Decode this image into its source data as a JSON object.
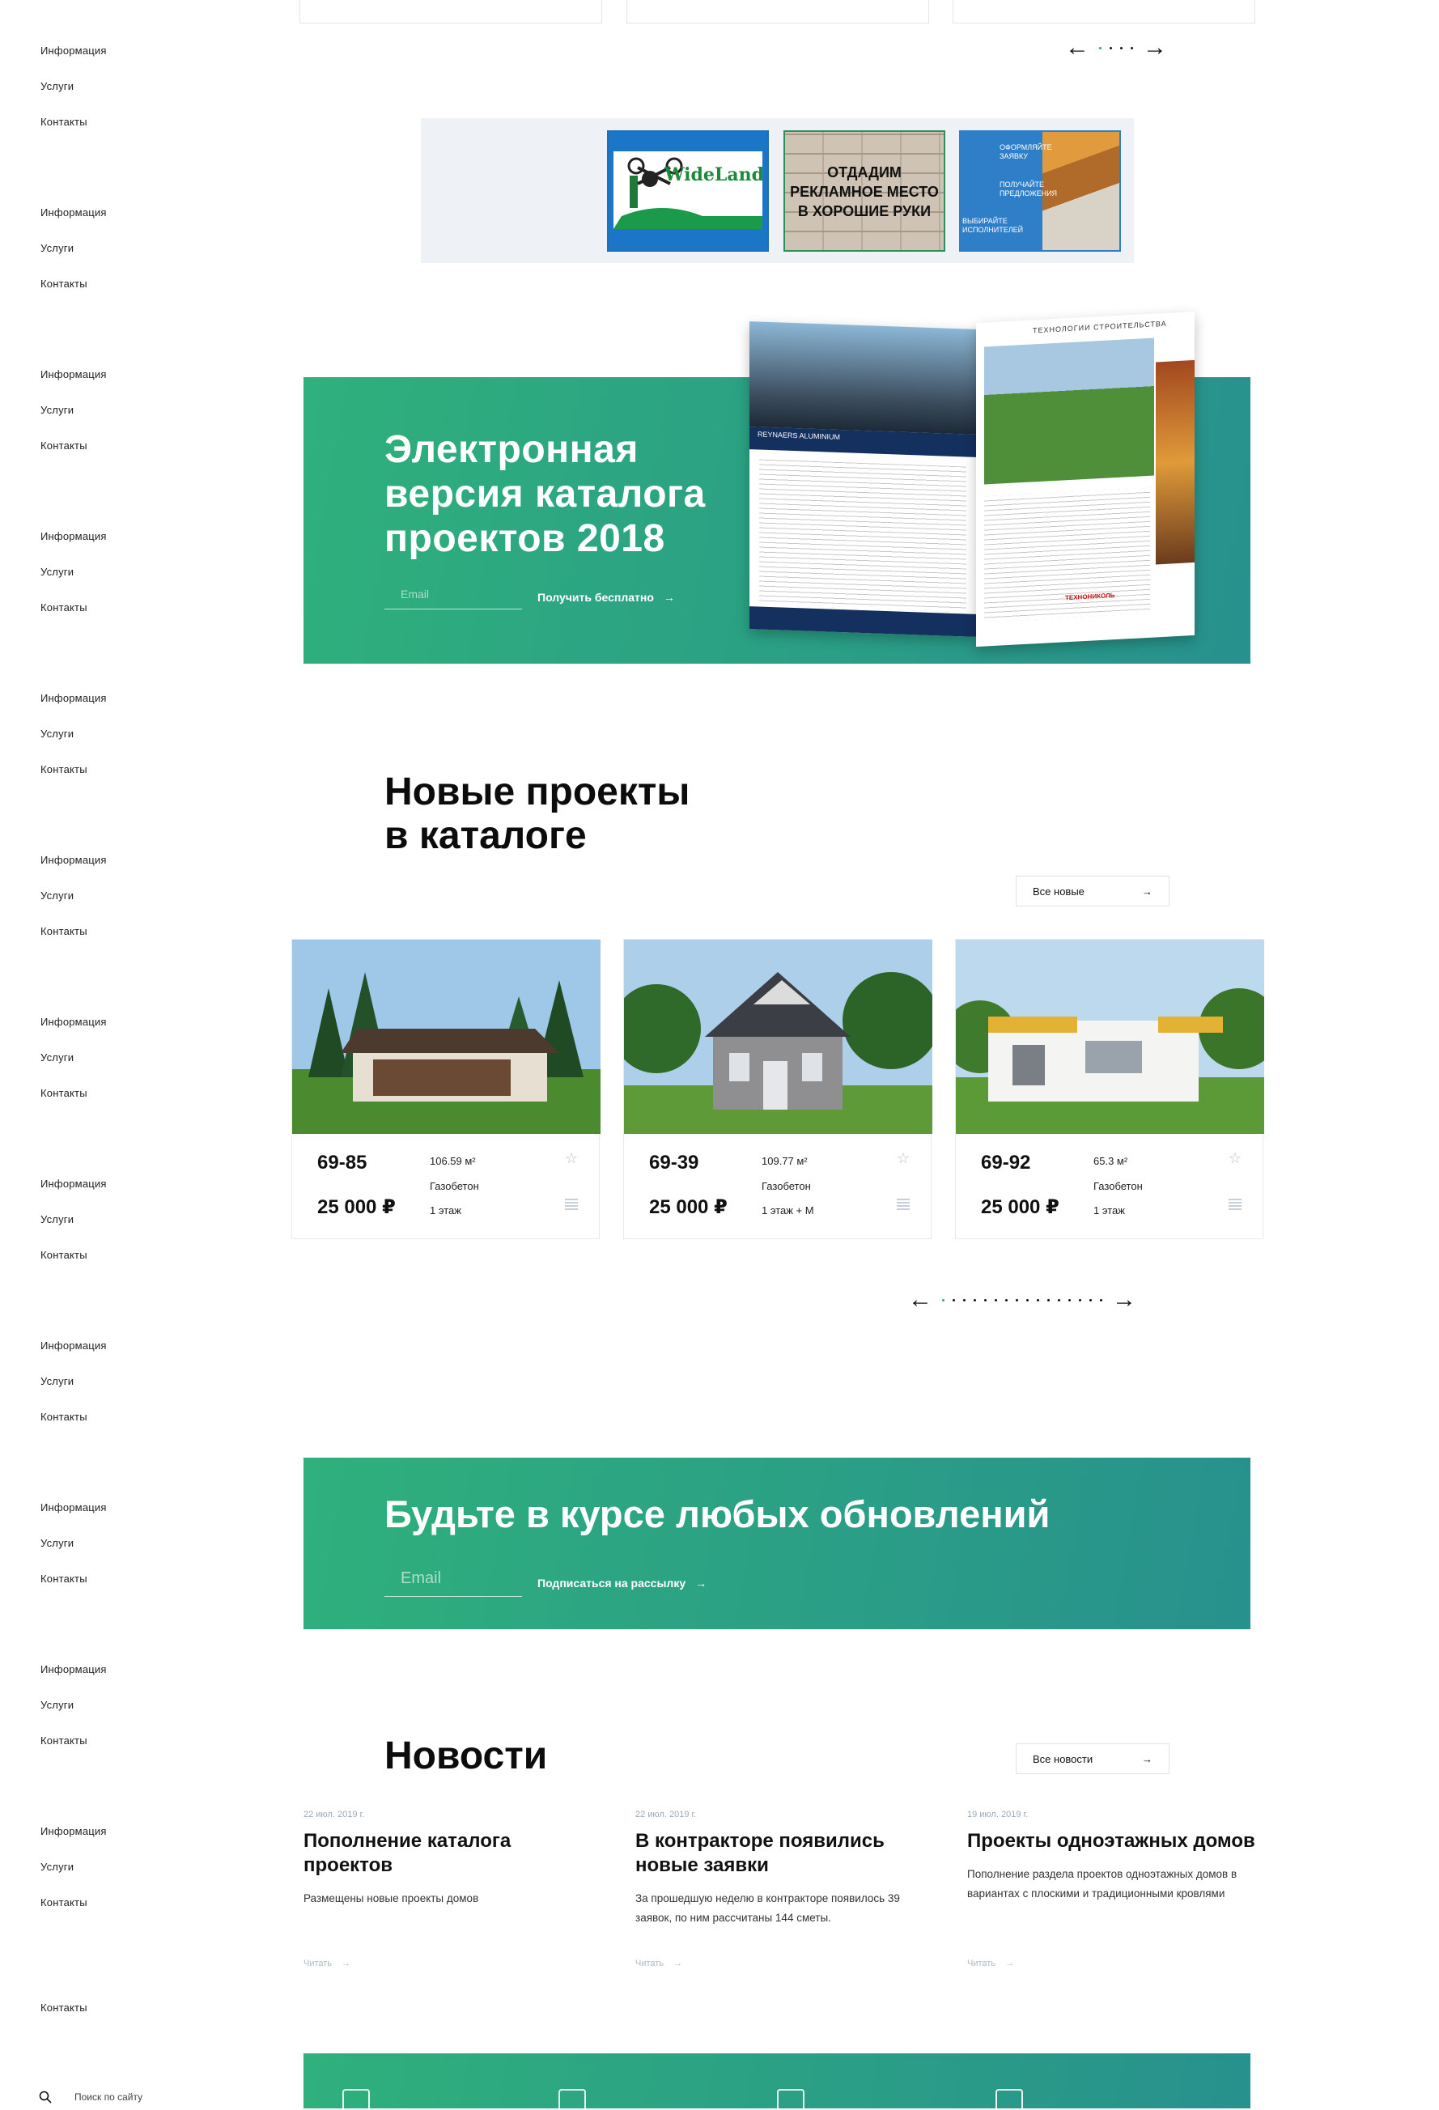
{
  "sidebar": {
    "groups": [
      {
        "items": [
          "Информация",
          "Услуги",
          "Контакты"
        ]
      },
      {
        "items": [
          "Информация",
          "Услуги",
          "Контакты"
        ]
      },
      {
        "items": [
          "Информация",
          "Услуги",
          "Контакты"
        ]
      },
      {
        "items": [
          "Информация",
          "Услуги",
          "Контакты"
        ]
      },
      {
        "items": [
          "Информация",
          "Услуги",
          "Контакты"
        ]
      },
      {
        "items": [
          "Информация",
          "Услуги",
          "Контакты"
        ]
      },
      {
        "items": [
          "Информация",
          "Услуги",
          "Контакты"
        ]
      },
      {
        "items": [
          "Информация",
          "Услуги",
          "Контакты"
        ]
      },
      {
        "items": [
          "Информация",
          "Услуги",
          "Контакты"
        ]
      },
      {
        "items": [
          "Информация",
          "Услуги",
          "Контакты"
        ]
      },
      {
        "items": [
          "Информация",
          "Услуги",
          "Контакты"
        ]
      },
      {
        "items": [
          "Информация",
          "Услуги",
          "Контакты"
        ]
      }
    ],
    "last_item": "Контакты",
    "search_placeholder": "Поиск по сайту"
  },
  "ads": {
    "ad1_brand": "WideLand",
    "ad2_text": [
      "ОТДАДИМ",
      "РЕКЛАМНОЕ МЕСТО",
      "В ХОРОШИЕ РУКИ"
    ],
    "ad3_lines": [
      "ОФОРМЛЯЙТЕ ЗАЯВКУ",
      "ПОЛУЧАЙТЕ ПРЕДЛОЖЕНИЯ",
      "ВЫБИРАЙТЕ ИСПОЛНИТЕЛЕЙ"
    ]
  },
  "catalog_banner": {
    "title": [
      "Электронная",
      "версия каталога",
      "проектов 2018"
    ],
    "email_placeholder": "Email",
    "cta": "Получить бесплатно",
    "magazine": {
      "left_band": "REYNAERS ALUMINIUM",
      "right_header": "ТЕХНОЛОГИИ СТРОИТЕЛЬСТВА",
      "right_logo": "ТЕХНОНИКОЛЬ"
    }
  },
  "new_projects": {
    "title": [
      "Новые проекты",
      "в каталоге"
    ],
    "all_button": "Все новые",
    "cards": [
      {
        "code": "69-85",
        "price": "25 000 ₽",
        "area": "106.59 м²",
        "material": "Газобетон",
        "floors": "1 этаж"
      },
      {
        "code": "69-39",
        "price": "25 000 ₽",
        "area": "109.77 м²",
        "material": "Газобетон",
        "floors": "1 этаж + М"
      },
      {
        "code": "69-92",
        "price": "25 000 ₽",
        "area": "65.3 м²",
        "material": "Газобетон",
        "floors": "1 этаж"
      }
    ]
  },
  "subscribe": {
    "title": "Будьте в курсе любых обновлений",
    "email_placeholder": "Email",
    "cta": "Подписаться на рассылку"
  },
  "news": {
    "title": "Новости",
    "all_button": "Все новости",
    "items": [
      {
        "date": "22 июл. 2019 г.",
        "title": "Пополнение каталога проектов",
        "desc": "Размещены новые проекты домов",
        "read": "Читать"
      },
      {
        "date": "22 июл. 2019 г.",
        "title": "В контракторе появились новые заявки",
        "desc": "За прошедшую неделю в контракторе появилось 39 заявок, по ним рассчитаны 144 сметы.",
        "read": "Читать"
      },
      {
        "date": "19 июл. 2019 г.",
        "title": "Проекты одноэтажных домов",
        "desc": "Пополнение раздела проектов одноэтажных домов в вариантах с плоскими и традиционными кровлями",
        "read": "Читать"
      }
    ]
  },
  "colors": {
    "accent": "#2aa384",
    "green_start": "#2fb07c",
    "green_end": "#27918d"
  }
}
